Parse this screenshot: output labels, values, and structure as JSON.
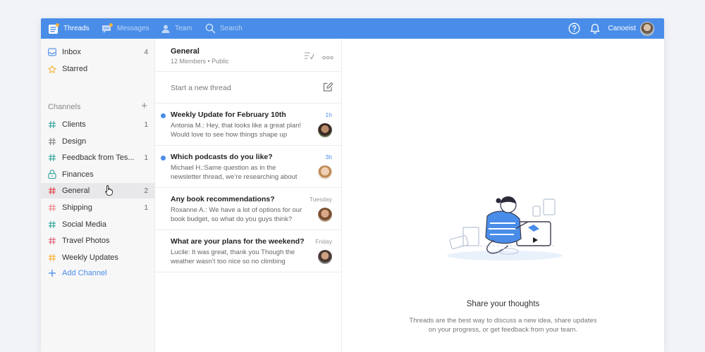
{
  "topbar": {
    "nav": [
      {
        "label": "Threads",
        "icon": "threads-icon",
        "active": true
      },
      {
        "label": "Messages",
        "icon": "messages-icon",
        "active": false
      },
      {
        "label": "Team",
        "icon": "team-icon",
        "active": false
      },
      {
        "label": "Search",
        "icon": "search-icon",
        "active": false
      }
    ],
    "username": "Canoeist",
    "accent": "#4a8de8"
  },
  "sidebar": {
    "inbox": {
      "label": "Inbox",
      "count": "4"
    },
    "starred": {
      "label": "Starred"
    },
    "channels_heading": "Channels",
    "channels": [
      {
        "label": "Clients",
        "count": "1",
        "color": "#3aa99f"
      },
      {
        "label": "Design",
        "count": "",
        "color": "#8a8a8a"
      },
      {
        "label": "Feedback from Tes...",
        "count": "1",
        "color": "#3aa99f"
      },
      {
        "label": "Finances",
        "count": "",
        "color": "#3aa99f",
        "icon": "lock-icon"
      },
      {
        "label": "General",
        "count": "2",
        "color": "#e0474c",
        "selected": true
      },
      {
        "label": "Shipping",
        "count": "1",
        "color": "#f08a8a"
      },
      {
        "label": "Social Media",
        "count": "",
        "color": "#3aa99f"
      },
      {
        "label": "Travel Photos",
        "count": "",
        "color": "#e0697a"
      },
      {
        "label": "Weekly Updates",
        "count": "",
        "color": "#f5b53a"
      }
    ],
    "add_channel": "Add Channel"
  },
  "thread_list": {
    "channel_name": "General",
    "channel_meta": "12 Members • Public",
    "new_thread_placeholder": "Start a new thread",
    "items": [
      {
        "title": "Weekly Update for February 10th",
        "time": "1h",
        "unread": true,
        "preview1": "Antonia M.: Hey, that looks like a great plan!",
        "preview2": "Would love to see how things shape up"
      },
      {
        "title": "Which podcasts do you like?",
        "time": "3h",
        "unread": true,
        "preview1": "Michael H.:Same question as in the",
        "preview2": "newsletter thread, we’re researching about"
      },
      {
        "title": "Any book recommendations?",
        "time": "Tuesday",
        "unread": false,
        "preview1": "Roxanne A.: We have a lot of options for our",
        "preview2": "book budget, so what do you guys think?"
      },
      {
        "title": "What are your plans for the weekend?",
        "time": "Friday",
        "unread": false,
        "preview1": "Lucile: It was great, thank you    Though the",
        "preview2": "weather wasn’t too nice so no climbing"
      }
    ]
  },
  "main": {
    "empty_title": "Share your thoughts",
    "empty_desc_line1": "Threads are the best way to discuss a new idea, share updates",
    "empty_desc_line2": "on your progress, or get feedback from your team."
  }
}
